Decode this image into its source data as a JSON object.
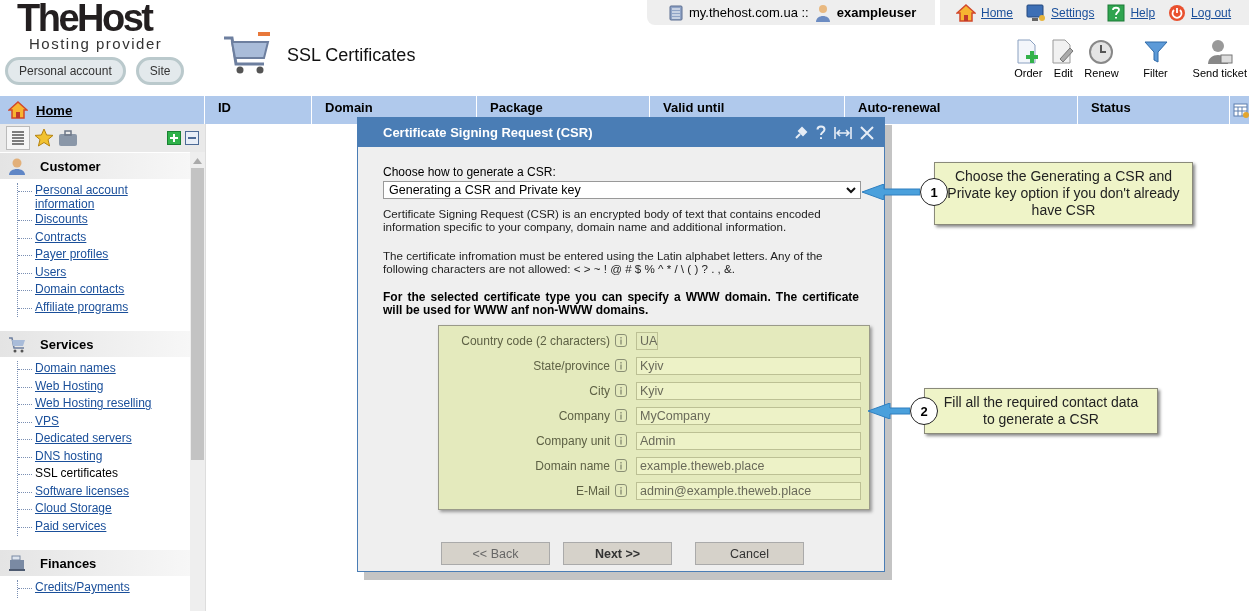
{
  "logo": {
    "name": "TheHost",
    "tagline": "Hosting provider"
  },
  "top_buttons": [
    "Personal account",
    "Site"
  ],
  "page_title": "SSL Certificates",
  "account_bar": {
    "host": "my.thehost.com.ua ::",
    "user": "exampleuser"
  },
  "top_links": [
    "Home",
    "Settings",
    "Help",
    "Log out"
  ],
  "toolbar": [
    "Order",
    "Edit",
    "Renew",
    "Filter",
    "Send ticket"
  ],
  "nav_home": "Home",
  "table": {
    "columns": [
      "ID",
      "Domain",
      "Package",
      "Valid until",
      "Auto-renewal",
      "Status"
    ]
  },
  "sidebar": {
    "sections": [
      {
        "title": "Customer",
        "items": [
          {
            "label": "Personal account information",
            "selected": false
          },
          {
            "label": "Discounts",
            "selected": false
          },
          {
            "label": "Contracts",
            "selected": false
          },
          {
            "label": "Payer profiles",
            "selected": false
          },
          {
            "label": "Users",
            "selected": false
          },
          {
            "label": "Domain contacts",
            "selected": false
          },
          {
            "label": "Affiliate programs",
            "selected": false
          }
        ]
      },
      {
        "title": "Services",
        "items": [
          {
            "label": "Domain names",
            "selected": false
          },
          {
            "label": "Web Hosting",
            "selected": false
          },
          {
            "label": "Web Hosting reselling",
            "selected": false
          },
          {
            "label": "VPS",
            "selected": false
          },
          {
            "label": "Dedicated servers",
            "selected": false
          },
          {
            "label": "DNS hosting",
            "selected": false
          },
          {
            "label": "SSL certificates",
            "selected": true
          },
          {
            "label": "Software licenses",
            "selected": false
          },
          {
            "label": "Cloud Storage",
            "selected": false
          },
          {
            "label": "Paid services",
            "selected": false
          }
        ]
      },
      {
        "title": "Finances",
        "items": [
          {
            "label": "Credits/Payments",
            "selected": false
          }
        ]
      }
    ]
  },
  "dialog": {
    "title": "Certificate Signing Request (CSR)",
    "select_label": "Choose how to generate a CSR:",
    "select_value": "Generating a CSR and Private key",
    "paragraphs": [
      "Certificate Signing Request (CSR) is an encrypted body of text that contains encoded information specific to your company, domain name and additional information.",
      "The certificate infromation must be entered using the Latin alphabet letters. Any of the following characters are not allowed: < > ~ ! @ # $ % ^ * / \\ ( ) ? . , &."
    ],
    "notice": "For the selected certificate type you can specify a WWW domain. The certificate will be used for WWW anf non-WWW domains.",
    "fields": [
      {
        "label": "Country code (2 characters)",
        "value": "UA",
        "kind": "code"
      },
      {
        "label": "State/province",
        "value": "Kyiv",
        "kind": "text"
      },
      {
        "label": "City",
        "value": "Kyiv",
        "kind": "text"
      },
      {
        "label": "Company",
        "value": "MyCompany",
        "kind": "text"
      },
      {
        "label": "Company unit",
        "value": "Admin",
        "kind": "text"
      },
      {
        "label": "Domain name",
        "value": "example.theweb.place",
        "kind": "text"
      },
      {
        "label": "E-Mail",
        "value": "admin@example.theweb.place",
        "kind": "text"
      }
    ],
    "buttons": [
      {
        "label": "<< Back",
        "kind": "back",
        "disabled": true
      },
      {
        "label": "Next >>",
        "kind": "primary",
        "disabled": false
      },
      {
        "label": "Cancel",
        "kind": "cancel",
        "disabled": false
      }
    ]
  },
  "callouts": [
    {
      "number": "1",
      "text": "Choose the Generating a CSR and Private key option if you don't already have CSR"
    },
    {
      "number": "2",
      "text": "Fill all the required contact data to generate a CSR"
    }
  ]
}
